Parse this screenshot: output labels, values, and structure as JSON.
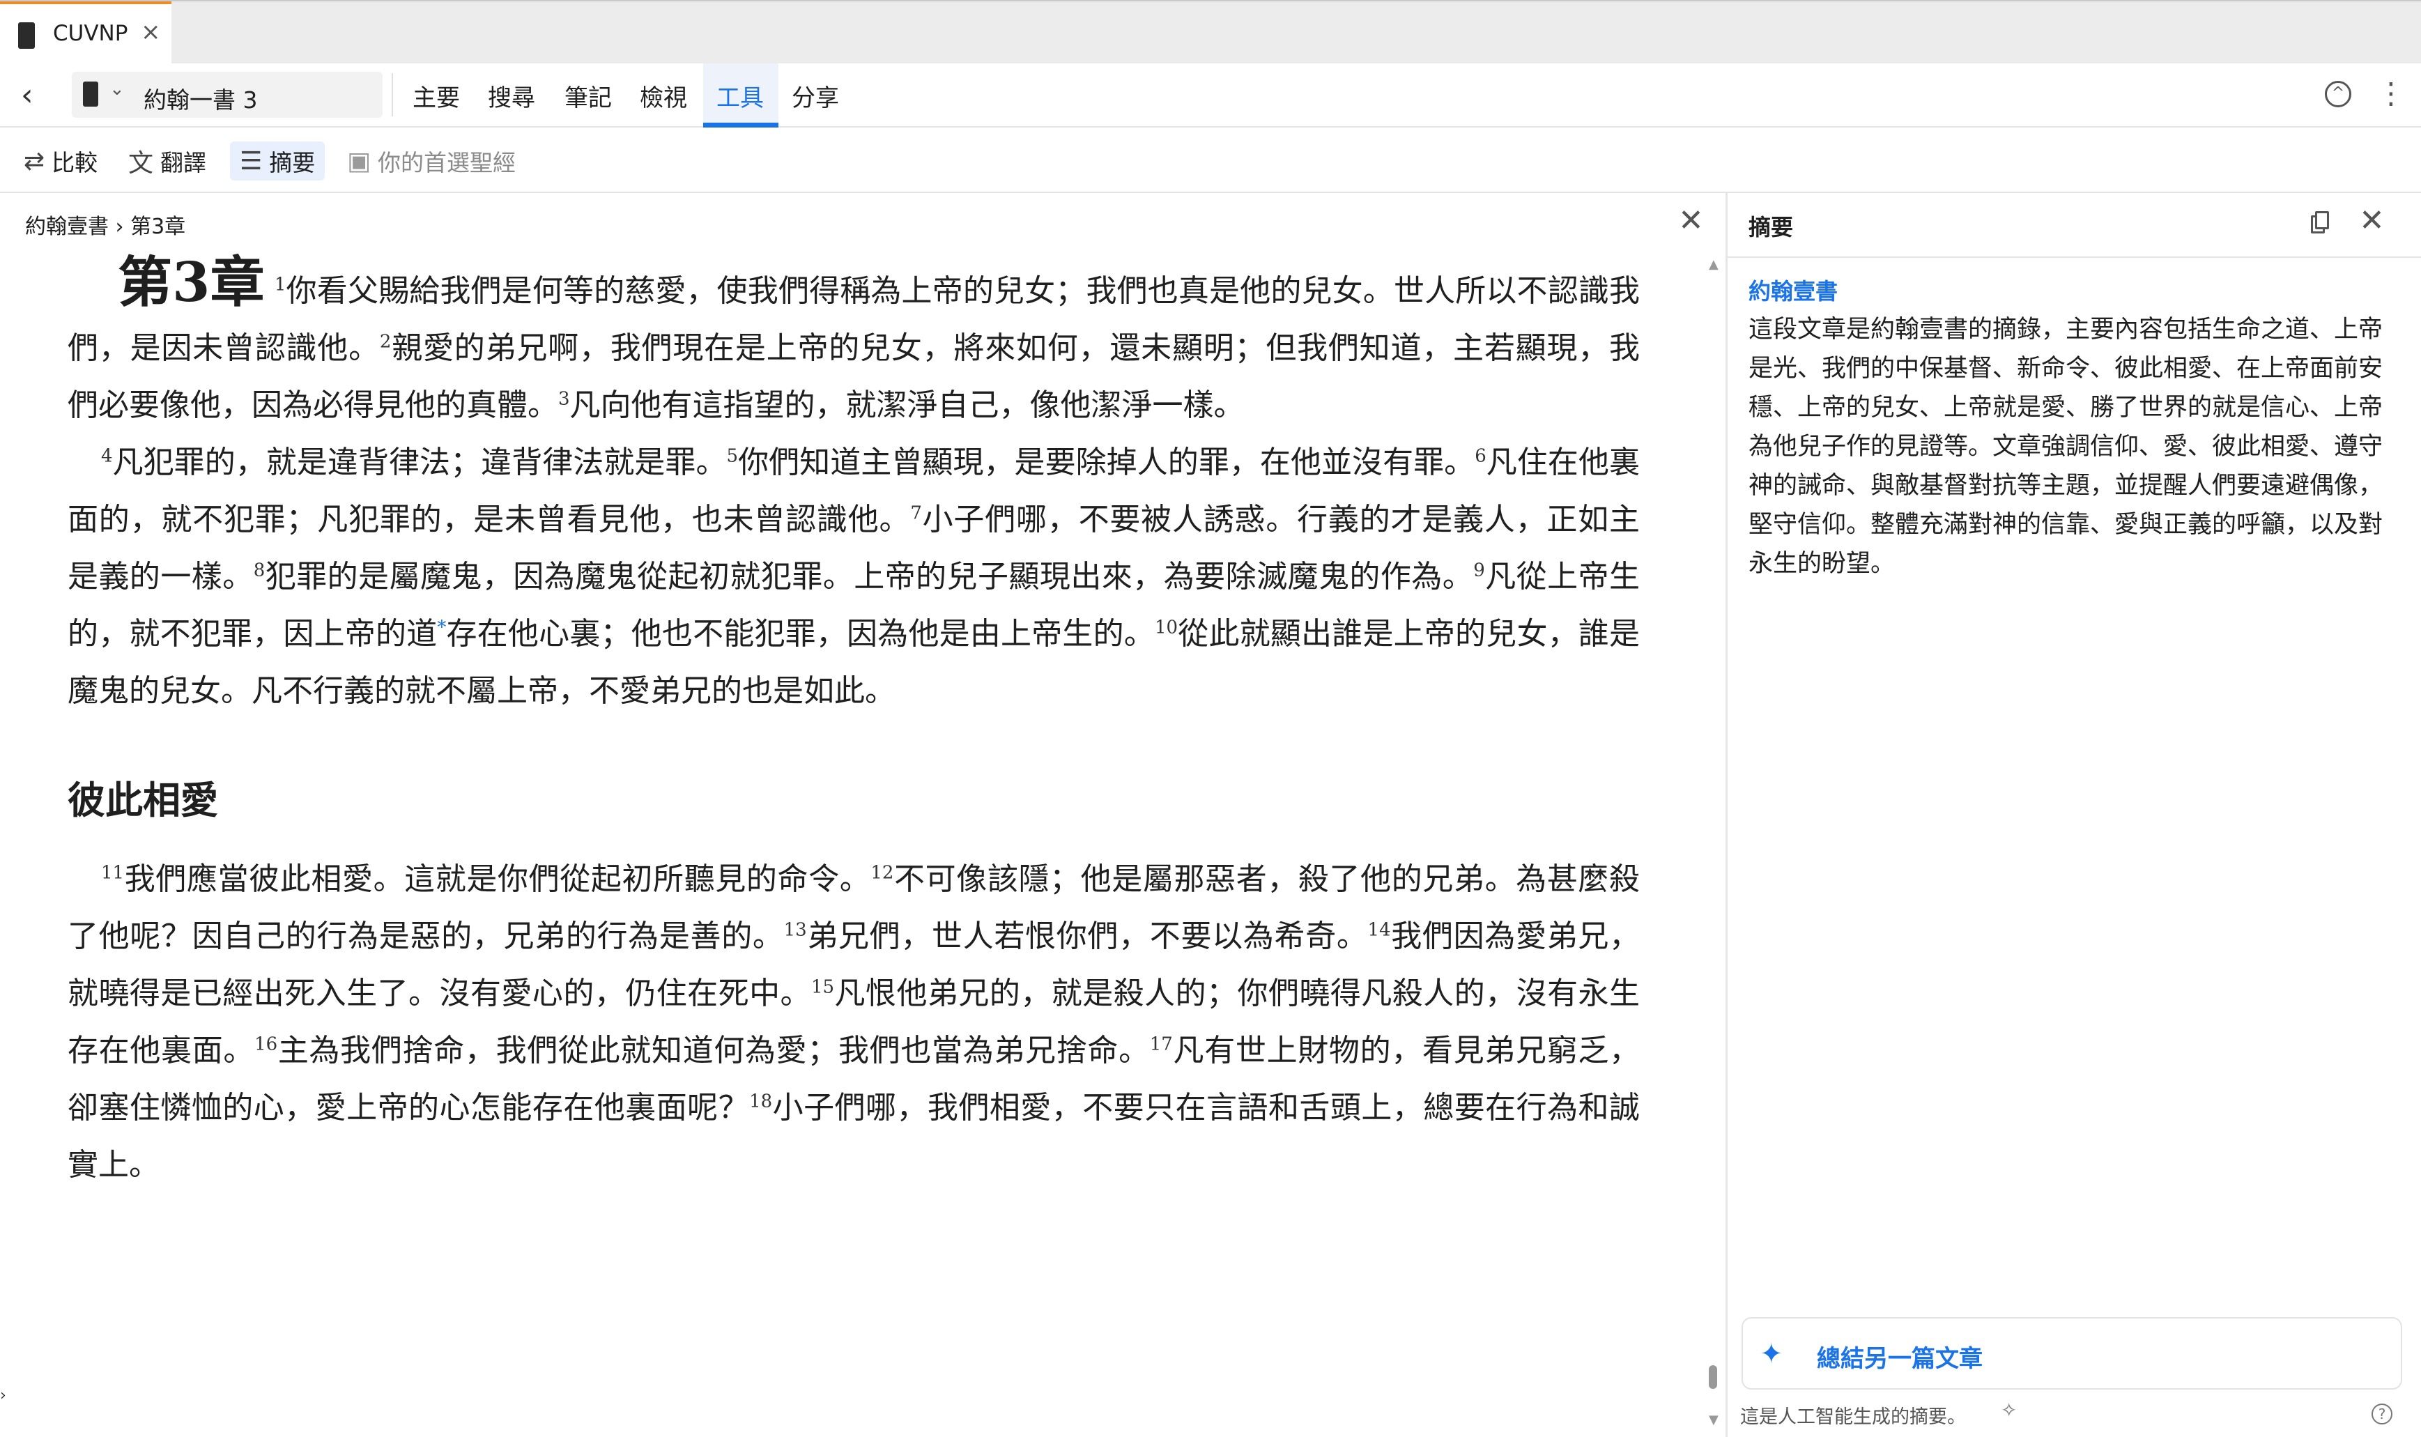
{
  "tab": {
    "title": "CUVNP",
    "close": "×"
  },
  "toolbar": {
    "back": "‹",
    "reference": "約翰一書 3",
    "chevron": "⌄",
    "menu": [
      "主要",
      "搜尋",
      "筆記",
      "檢視",
      "工具",
      "分享"
    ],
    "active_menu": "工具"
  },
  "subtoolbar": {
    "compare": "比較",
    "translate": "翻譯",
    "summary": "摘要",
    "preferred_bible": "你的首選聖經"
  },
  "left": {
    "breadcrumb": "約翰壹書 › 第3章",
    "close": "✕",
    "chapter_label": "第3章",
    "paragraphs": {
      "p1": [
        {
          "n": "1",
          "t": "你看父賜給我們是何等的慈愛，使我們得稱為上帝的兒女；我們也真是他的兒女。世人所以不認識我們，是因未曾認識他。"
        },
        {
          "n": "2",
          "t": "親愛的弟兄啊，我們現在是上帝的兒女，將來如何，還未顯明；但我們知道，主若顯現，我們必要像他，因為必得見他的真體。"
        },
        {
          "n": "3",
          "t": "凡向他有這指望的，就潔淨自己，像他潔淨一樣。"
        }
      ],
      "p2": [
        {
          "n": "4",
          "t": "凡犯罪的，就是違背律法；違背律法就是罪。"
        },
        {
          "n": "5",
          "t": "你們知道主曾顯現，是要除掉人的罪，在他並沒有罪。"
        },
        {
          "n": "6",
          "t": "凡住在他裏面的，就不犯罪；凡犯罪的，是未曾看見他，也未曾認識他。"
        },
        {
          "n": "7",
          "t": "小子們哪，不要被人誘惑。行義的才是義人，正如主是義的一樣。"
        },
        {
          "n": "8",
          "t": "犯罪的是屬魔鬼，因為魔鬼從起初就犯罪。上帝的兒子顯現出來，為要除滅魔鬼的作為。"
        },
        {
          "n": "9",
          "t": "凡從上帝生的，就不犯罪，因上帝的道"
        },
        {
          "n": "",
          "t": "存在他心裏；他也不能犯罪，因為他是由上帝生的。"
        },
        {
          "n": "10",
          "t": "從此就顯出誰是上帝的兒女，誰是魔鬼的兒女。凡不行義的就不屬上帝，不愛弟兄的也是如此。"
        }
      ],
      "note_mark": "*",
      "section_heading": "彼此相愛",
      "p3": [
        {
          "n": "11",
          "t": "我們應當彼此相愛。這就是你們從起初所聽見的命令。"
        },
        {
          "n": "12",
          "t": "不可像該隱；他是屬那惡者，殺了他的兄弟。為甚麼殺了他呢？因自己的行為是惡的，兄弟的行為是善的。"
        },
        {
          "n": "13",
          "t": "弟兄們，世人若恨你們，不要以為希奇。"
        },
        {
          "n": "14",
          "t": "我們因為愛弟兄，就曉得是已經出死入生了。沒有愛心的，仍住在死中。"
        },
        {
          "n": "15",
          "t": "凡恨他弟兄的，就是殺人的；你們曉得凡殺人的，沒有永生存在他裏面。"
        },
        {
          "n": "16",
          "t": "主為我們捨命，我們從此就知道何為愛；我們也當為弟兄捨命。"
        },
        {
          "n": "17",
          "t": "凡有世上財物的，看見弟兄窮乏，卻塞住憐恤的心，愛上帝的心怎能存在他裏面呢？"
        },
        {
          "n": "18",
          "t": "小子們哪，我們相愛，不要只在言語和舌頭上，總要在行為和誠實上。"
        }
      ]
    }
  },
  "right": {
    "title": "摘要",
    "close": "✕",
    "book": "約翰壹書",
    "summary": "這段文章是約翰壹書的摘錄，主要內容包括生命之道、上帝是光、我們的中保基督、新命令、彼此相愛、在上帝面前安穩、上帝的兒女、上帝就是愛、勝了世界的就是信心、上帝為他兒子作的見證等。文章強調信仰、愛、彼此相愛、遵守神的誡命、與敵基督對抗等主題，並提醒人們要遠避偶像，堅守信仰。整體充滿對神的信靠、愛與正義的呼籲，以及對永生的盼望。",
    "summarize_button": "總結另一篇文章",
    "ai_note": "這是人工智能生成的摘要。",
    "help": "?"
  },
  "colors": {
    "accent": "#1a73e8",
    "tab_highlight": "#f08a24"
  }
}
